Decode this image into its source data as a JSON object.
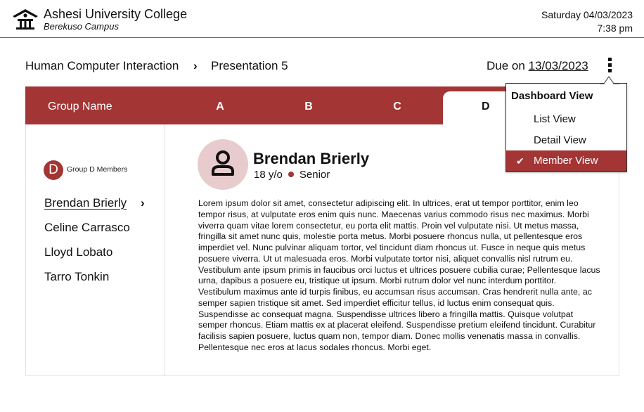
{
  "header": {
    "title": "Ashesi University College",
    "subtitle": "Berekuso Campus",
    "date": "Saturday 04/03/2023",
    "time": "7:38 pm"
  },
  "breadcrumb": {
    "course": "Human Computer Interaction",
    "page": "Presentation 5",
    "separator": "›"
  },
  "due": {
    "label": "Due on",
    "date": "13/03/2023"
  },
  "tabs": {
    "group_name_label": "Group Name",
    "items": [
      "A",
      "B",
      "C",
      "D"
    ],
    "active": "D"
  },
  "sidebar": {
    "badge": "D",
    "label": "Group D Members",
    "members": [
      "Brendan Brierly",
      "Celine Carrasco",
      "Lloyd Lobato",
      "Tarro Tonkin"
    ],
    "selected": "Brendan Brierly"
  },
  "profile": {
    "name": "Brendan Brierly",
    "age": "18 y/o",
    "level": "Senior",
    "bio": "Lorem ipsum dolor sit amet, consectetur adipiscing elit. In ultrices, erat ut tempor porttitor, enim leo tempor risus, at vulputate eros enim quis nunc. Maecenas varius commodo risus nec maximus. Morbi viverra quam vitae lorem consectetur, eu porta elit mattis. Proin vel vulputate nisi. Ut metus massa, fringilla sit amet nunc quis, molestie porta metus. Morbi posuere rhoncus nulla, ut pellentesque eros imperdiet vel. Nunc pulvinar aliquam tortor, vel tincidunt diam rhoncus ut. Fusce in neque quis metus posuere viverra. Ut ut malesuada eros. Morbi vulputate tortor nisi, aliquet convallis nisl rutrum eu. Vestibulum ante ipsum primis in faucibus orci luctus et ultrices posuere cubilia curae; Pellentesque lacus urna, dapibus a posuere eu, tristique ut ipsum. Morbi rutrum dolor vel nunc interdum porttitor. Vestibulum maximus ante id turpis finibus, eu accumsan risus accumsan. Cras hendrerit nulla ante, ac semper sapien tristique sit amet. Sed imperdiet efficitur tellus, id luctus enim consequat quis. Suspendisse ac consequat magna. Suspendisse ultrices libero a fringilla mattis. Quisque volutpat semper rhoncus. Etiam mattis ex at placerat eleifend. Suspendisse pretium eleifend tincidunt. Curabitur facilisis sapien posuere, luctus quam non, tempor diam. Donec mollis venenatis massa in convallis. Pellentesque nec eros at lacus sodales rhoncus. Morbi eget."
  },
  "menu": {
    "title": "Dashboard View",
    "items": [
      "List View",
      "Detail View",
      "Member View"
    ],
    "selected": "Member View"
  },
  "colors": {
    "accent": "#a33535",
    "avatar_bg": "#e8cccd"
  }
}
